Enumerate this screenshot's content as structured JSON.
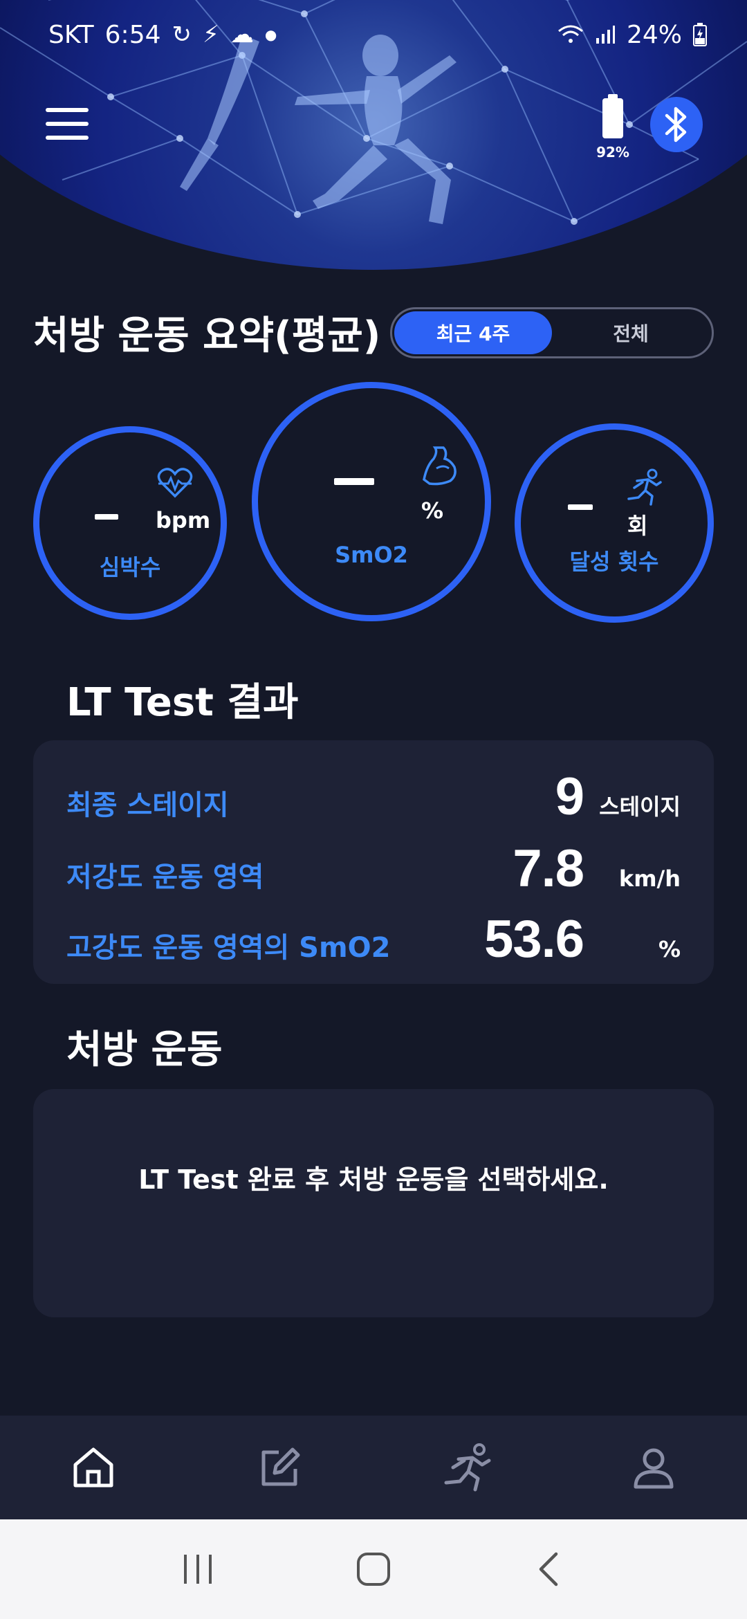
{
  "status_bar": {
    "carrier": "SKT",
    "time": "6:54",
    "battery": "24%"
  },
  "header": {
    "device_battery": "92%"
  },
  "summary": {
    "title": "처방 운동 요약(평균)",
    "tabs": [
      {
        "label": "최근 4주",
        "active": true
      },
      {
        "label": "전체",
        "active": false
      }
    ],
    "stats": [
      {
        "label": "심박수",
        "unit": "bpm",
        "value": "-",
        "icon": "heart-rate-icon"
      },
      {
        "label": "SmO2",
        "unit": "%",
        "value": "-",
        "icon": "muscle-arm-icon"
      },
      {
        "label": "달성 횟수",
        "unit": "회",
        "value": "-",
        "icon": "runner-icon"
      }
    ]
  },
  "lt_test": {
    "title": "LT Test 결과",
    "rows": [
      {
        "label": "최종 스테이지",
        "value": "9",
        "unit": "스테이지"
      },
      {
        "label": "저강도 운동 영역",
        "value": "7.8",
        "unit": "km/h"
      },
      {
        "label": "고강도 운동 영역의 SmO2",
        "value": "53.6",
        "unit": "%"
      }
    ]
  },
  "exercise": {
    "title": "처방 운동",
    "message": "LT Test 완료 후 처방 운동을 선택하세요."
  },
  "bottom_nav": {
    "items": [
      "home-icon",
      "edit-icon",
      "runner-icon",
      "profile-icon"
    ],
    "active": "home-icon"
  },
  "colors": {
    "accent": "#2d62f5",
    "label_blue": "#3d8af7",
    "background": "#141828",
    "card": "#1e2236"
  }
}
